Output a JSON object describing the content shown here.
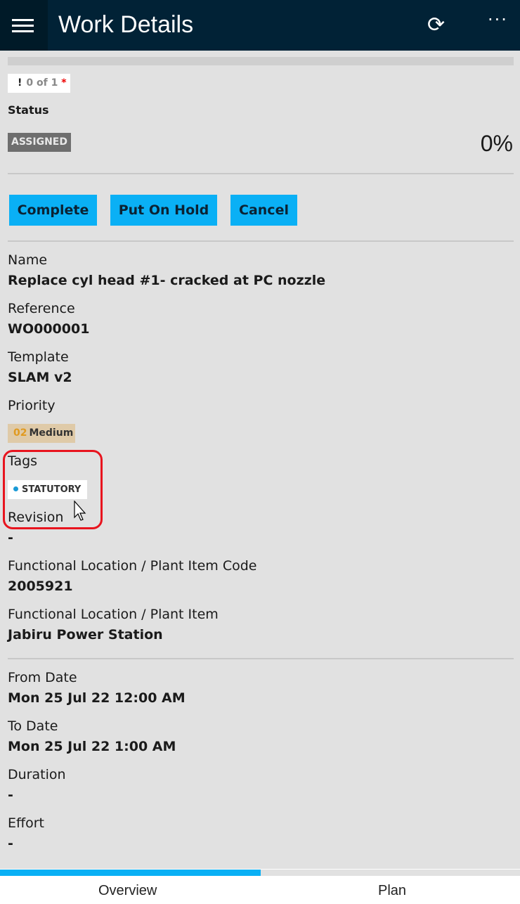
{
  "header": {
    "title": "Work Details",
    "menu_icon": "hamburger-icon",
    "sync_icon": "sync-icon",
    "more_label": "···"
  },
  "required": {
    "icon": "!",
    "text": "0 of 1",
    "asterisk": "*"
  },
  "status": {
    "label": "Status",
    "value": "ASSIGNED",
    "progress": "0%"
  },
  "actions": {
    "complete": "Complete",
    "hold": "Put On Hold",
    "cancel": "Cancel"
  },
  "fields": [
    {
      "label": "Name",
      "value": "Replace cyl head #1- cracked at PC nozzle"
    },
    {
      "label": "Reference",
      "value": "WO000001"
    },
    {
      "label": "Template",
      "value": "SLAM v2"
    },
    {
      "label": "Priority"
    },
    {
      "label": "Tags"
    },
    {
      "label": "Revision",
      "value": "-"
    },
    {
      "label": "Functional Location / Plant Item Code",
      "value": "2005921"
    },
    {
      "label": "Functional Location / Plant Item",
      "value": "Jabiru Power Station"
    }
  ],
  "priority": {
    "code": "02",
    "label": "Medium",
    "color": "#e09a20"
  },
  "tags": [
    {
      "label": "STATUTORY",
      "color": "#1a9ad6"
    }
  ],
  "dates": [
    {
      "label": "From Date",
      "value": "Mon 25 Jul 22 12:00 AM"
    },
    {
      "label": "To Date",
      "value": "Mon 25 Jul 22 1:00 AM"
    },
    {
      "label": "Duration",
      "value": "-"
    },
    {
      "label": "Effort",
      "value": "-"
    }
  ],
  "tabs": [
    {
      "label": "Overview",
      "active": true
    },
    {
      "label": "Plan",
      "active": false
    }
  ],
  "colors": {
    "accent": "#0ab0f5",
    "header": "#012236",
    "highlight": "#e8141e"
  }
}
